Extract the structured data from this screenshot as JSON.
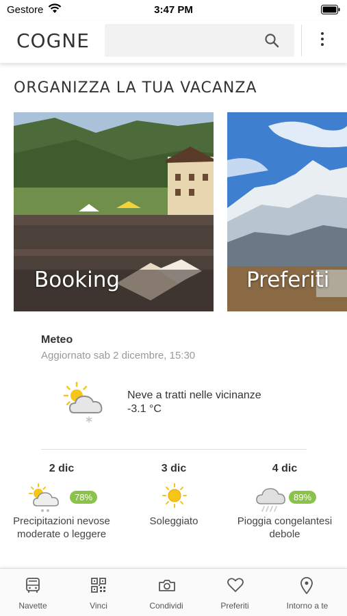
{
  "status_bar": {
    "carrier": "Gestore",
    "time": "3:47 PM"
  },
  "header": {
    "title": "COGNE",
    "search_placeholder": ""
  },
  "section_title": "ORGANIZZA LA TUA VACANZA",
  "cards": [
    {
      "label": "Booking"
    },
    {
      "label": "Preferiti"
    }
  ],
  "meteo": {
    "title": "Meteo",
    "updated": "Aggiornato sab 2 dicembre, 15:30",
    "current": {
      "description": "Neve a tratti nelle vicinanze",
      "temperature": "-3.1 °C",
      "icon": "snow-cloud-sun-icon"
    },
    "forecast": [
      {
        "date": "2 dic",
        "badge": "78%",
        "description": "Precipitazioni nevose moderate o leggere",
        "icon": "snow-cloud-sun-icon"
      },
      {
        "date": "3 dic",
        "badge": "",
        "description": "Soleggiato",
        "icon": "sun-icon"
      },
      {
        "date": "4 dic",
        "badge": "89%",
        "description": "Pioggia congelantesi debole",
        "icon": "freezing-rain-cloud-icon"
      }
    ]
  },
  "bottom_nav": [
    {
      "label": "Navette",
      "icon": "bus-icon"
    },
    {
      "label": "Vinci",
      "icon": "qr-code-icon"
    },
    {
      "label": "Condividi",
      "icon": "camera-icon"
    },
    {
      "label": "Preferiti",
      "icon": "heart-icon"
    },
    {
      "label": "Intorno a te",
      "icon": "location-pin-icon"
    }
  ],
  "colors": {
    "badge": "#8bc34a",
    "sun": "#f5c518",
    "cloud": "#d6d6d6"
  }
}
